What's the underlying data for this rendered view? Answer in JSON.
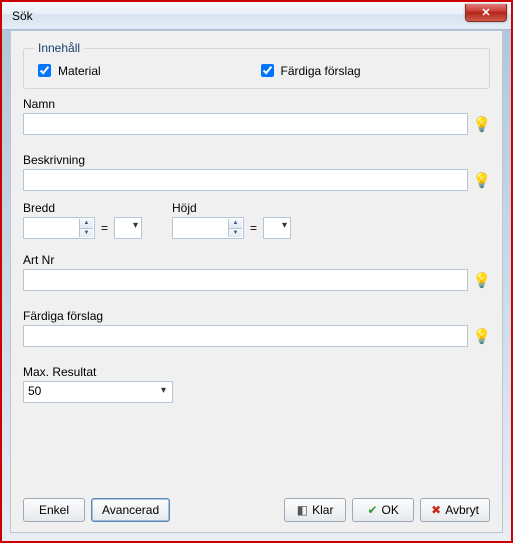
{
  "window": {
    "title": "Sök"
  },
  "group": {
    "legend": "Innehåll"
  },
  "checks": {
    "material": {
      "label": "Material",
      "checked": true
    },
    "fardiga": {
      "label": "Färdiga förslag",
      "checked": true
    }
  },
  "fields": {
    "namn": {
      "label": "Namn",
      "value": ""
    },
    "beskr": {
      "label": "Beskrivning",
      "value": ""
    },
    "bredd": {
      "label": "Bredd",
      "value": ""
    },
    "hojd": {
      "label": "Höjd",
      "value": ""
    },
    "artnr": {
      "label": "Art Nr",
      "value": ""
    },
    "fforslag": {
      "label": "Färdiga förslag",
      "value": ""
    },
    "maxres": {
      "label": "Max. Resultat",
      "value": "50"
    }
  },
  "ops": {
    "eq": "="
  },
  "buttons": {
    "enkel": "Enkel",
    "avancerad": "Avancerad",
    "klar": "Klar",
    "ok": "OK",
    "avbryt": "Avbryt"
  }
}
